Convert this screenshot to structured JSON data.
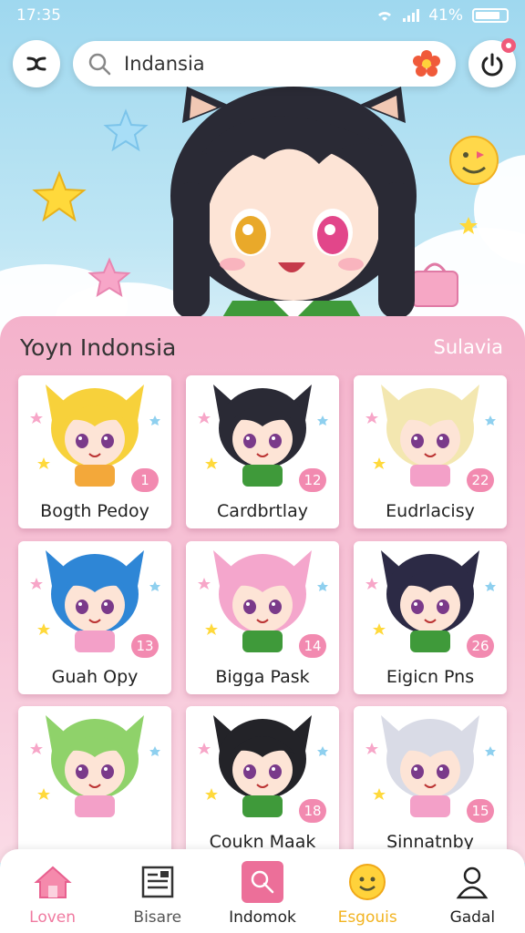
{
  "status": {
    "time": "17:35",
    "battery": "41%"
  },
  "search": {
    "query": "Indansia"
  },
  "section": {
    "title": "Yoyn Indonsia",
    "link": "Sulavia"
  },
  "cards": [
    {
      "name": "Bogth Pedoy",
      "badge": "1",
      "hair": "#f7d13b",
      "shirt": "#f3a83a"
    },
    {
      "name": "Cardbrtlay",
      "badge": "12",
      "hair": "#2a2a35",
      "shirt": "#3f9a3a"
    },
    {
      "name": "Eudrlacisy",
      "badge": "22",
      "hair": "#f3e7b0",
      "shirt": "#f3a0c8"
    },
    {
      "name": "Guah Opy",
      "badge": "13",
      "hair": "#2e86d6",
      "shirt": "#f3a0c8"
    },
    {
      "name": "Bigga Pask",
      "badge": "14",
      "hair": "#f4a6cc",
      "shirt": "#3f9a3a"
    },
    {
      "name": "Eigicn Pns",
      "badge": "26",
      "hair": "#2c2a45",
      "shirt": "#3f9a3a"
    },
    {
      "name": "",
      "badge": "",
      "hair": "#8fd26a",
      "shirt": "#f3a0c8"
    },
    {
      "name": "Coukn Maak",
      "badge": "18",
      "hair": "#232328",
      "shirt": "#3f9a3a"
    },
    {
      "name": "Sinnatnby",
      "badge": "15",
      "hair": "#d9dbe6",
      "shirt": "#f3a0c8"
    }
  ],
  "nav": [
    {
      "label": "Loven",
      "color": "#f07aa0",
      "icon": "home-icon"
    },
    {
      "label": "Bisare",
      "color": "#555555",
      "icon": "news-icon"
    },
    {
      "label": "Indomok",
      "color": "#222222",
      "icon": "edit-icon"
    },
    {
      "label": "Esgouis",
      "color": "#f2b320",
      "icon": "smiley-icon"
    },
    {
      "label": "Gadal",
      "color": "#222222",
      "icon": "profile-icon"
    }
  ],
  "colors": {
    "accent": "#f28ab0",
    "sky": "#9fd8ef",
    "panel": "#f4b2cb"
  }
}
